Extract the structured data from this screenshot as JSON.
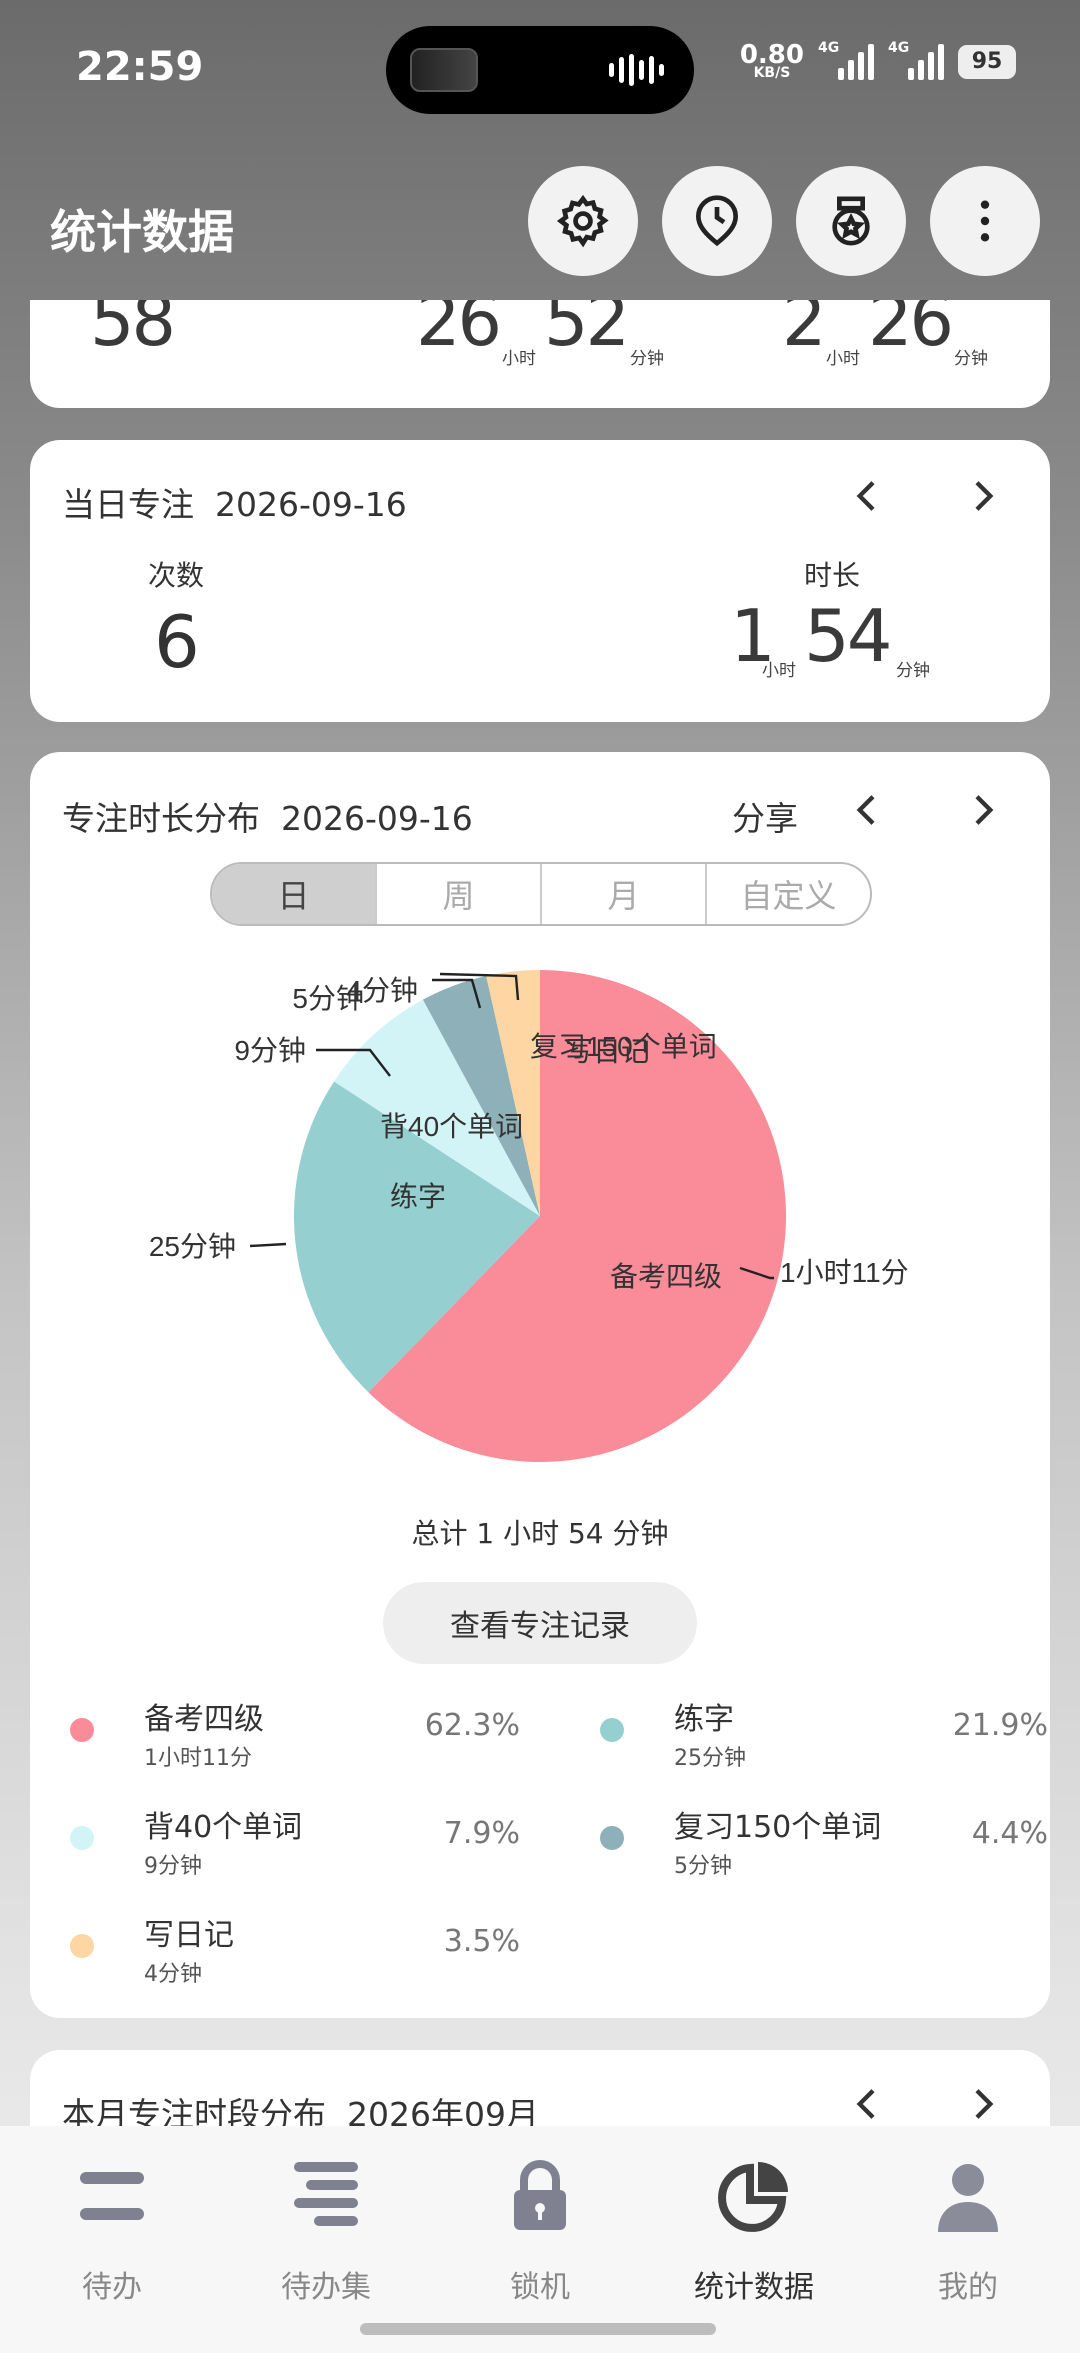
{
  "status_bar": {
    "time": "22:59",
    "net_speed": "0.80",
    "net_unit": "KB/S",
    "sig1": "4G",
    "sig2": "4G",
    "battery": "95"
  },
  "header": {
    "title": "统计数据",
    "buttons": [
      "settings-icon",
      "clock-pin-icon",
      "badge-icon",
      "more-icon"
    ]
  },
  "summary": {
    "count": "58",
    "total_hours": "26",
    "total_hours_unit": "小时",
    "total_minutes": "52",
    "total_minutes_unit": "分钟",
    "avg_hours": "2",
    "avg_hours_unit": "小时",
    "avg_minutes": "26",
    "avg_minutes_unit": "分钟"
  },
  "daily": {
    "title": "当日专注",
    "date": "2026-09-16",
    "count_label": "次数",
    "count_value": "6",
    "duration_label": "时长",
    "duration_hours": "1",
    "duration_hours_unit": "小时",
    "duration_minutes": "54",
    "duration_minutes_unit": "分钟"
  },
  "distribution": {
    "title": "专注时长分布",
    "date": "2026-09-16",
    "share_label": "分享",
    "tabs": [
      "日",
      "周",
      "月",
      "自定义"
    ],
    "active_tab": "日",
    "total_text": "总计 1 小时 54 分钟",
    "record_button": "查看专注记录",
    "colors": [
      "#fa8b99",
      "#95cfd0",
      "#d3f4f7",
      "#8eb1b9",
      "#fdd6a3"
    ],
    "legend": [
      {
        "name": "备考四级",
        "duration": "1小时11分",
        "percent": "62.3%"
      },
      {
        "name": "练字",
        "duration": "25分钟",
        "percent": "21.9%"
      },
      {
        "name": "背40个单词",
        "duration": "9分钟",
        "percent": "7.9%"
      },
      {
        "name": "复习150个单词",
        "duration": "5分钟",
        "percent": "4.4%"
      },
      {
        "name": "写日记",
        "duration": "4分钟",
        "percent": "3.5%"
      }
    ],
    "pie_labels": {
      "outer": [
        "1小时11分",
        "25分钟",
        "9分钟",
        "5分钟",
        "4分钟"
      ]
    }
  },
  "chart_data": {
    "type": "pie",
    "categories": [
      "备考四级",
      "练字",
      "背40个单词",
      "复习150个单词",
      "写日记"
    ],
    "values": [
      71,
      25,
      9,
      5,
      4
    ],
    "value_labels": [
      "1小时11分",
      "25分钟",
      "9分钟",
      "5分钟",
      "4分钟"
    ],
    "percentages": [
      62.3,
      21.9,
      7.9,
      4.4,
      3.5
    ],
    "colors": [
      "#fa8b99",
      "#95cfd0",
      "#d3f4f7",
      "#8eb1b9",
      "#fdd6a3"
    ]
  },
  "monthly": {
    "title": "本月专注时段分布",
    "date": "2026年09月"
  },
  "bottom_nav": [
    {
      "label": "待办",
      "icon": "todo-list-icon"
    },
    {
      "label": "待办集",
      "icon": "todo-collection-icon"
    },
    {
      "label": "锁机",
      "icon": "lock-icon"
    },
    {
      "label": "统计数据",
      "icon": "pie-chart-icon",
      "active": true
    },
    {
      "label": "我的",
      "icon": "user-icon"
    }
  ]
}
